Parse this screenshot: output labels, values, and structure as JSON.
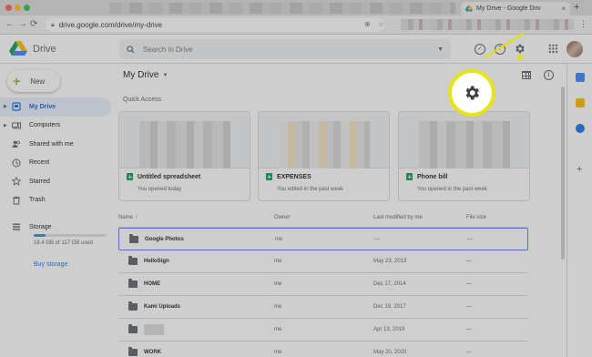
{
  "browser": {
    "tab_title": "My Drive - Google Driv",
    "url": "drive.google.com/drive/my-drive"
  },
  "header": {
    "product_name": "Drive",
    "search_placeholder": "Search in Drive"
  },
  "sidebar": {
    "new_label": "New",
    "items": [
      {
        "label": "My Drive",
        "icon": "my-drive-icon",
        "active": true
      },
      {
        "label": "Computers",
        "icon": "computers-icon",
        "active": false
      },
      {
        "label": "Shared with me",
        "icon": "shared-icon",
        "active": false
      },
      {
        "label": "Recent",
        "icon": "clock-icon",
        "active": false
      },
      {
        "label": "Starred",
        "icon": "star-icon",
        "active": false
      },
      {
        "label": "Trash",
        "icon": "trash-icon",
        "active": false
      }
    ],
    "storage_label": "Storage",
    "storage_usage": "18.4 GB of 117 GB used",
    "storage_fraction": 0.157,
    "buy_storage": "Buy storage"
  },
  "main": {
    "title": "My Drive",
    "quick_access_label": "Quick Access",
    "quick_access": [
      {
        "name": "Untitled spreadsheet",
        "subtitle": "You opened today"
      },
      {
        "name": "EXPENSES",
        "subtitle": "You edited in the past week"
      },
      {
        "name": "Phone bill",
        "subtitle": "You opened in the past week"
      }
    ],
    "columns": {
      "name": "Name",
      "owner": "Owner",
      "modified": "Last modified by me",
      "size": "File size"
    },
    "rows": [
      {
        "name": "Google Photos",
        "owner": "me",
        "modified": "—",
        "size": "—"
      },
      {
        "name": "HelloSign",
        "owner": "me",
        "modified": "May 23, 2013",
        "size": "—"
      },
      {
        "name": "HOME",
        "owner": "me",
        "modified": "Dec 17, 2014",
        "size": "—"
      },
      {
        "name": "Kami Uploads",
        "owner": "me",
        "modified": "Dec 19, 2017",
        "size": "—"
      },
      {
        "name": "",
        "owner": "me",
        "modified": "Apr 13, 2019",
        "size": "—"
      },
      {
        "name": "WORK",
        "owner": "me",
        "modified": "May 20, 2020",
        "size": "—"
      }
    ]
  },
  "colors": {
    "accent": "#1a73e8",
    "active_bg": "#e8f0fe",
    "highlight_ring": "#e8e21a",
    "sheets_green": "#0f9d58"
  }
}
